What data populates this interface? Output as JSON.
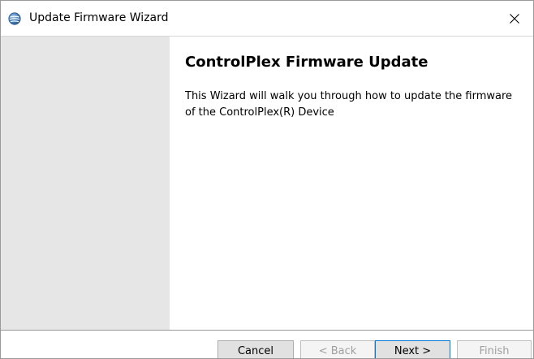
{
  "window": {
    "title": "Update Firmware Wizard",
    "icon": "globe-app-icon",
    "close_glyph": "✕"
  },
  "page": {
    "heading": "ControlPlex Firmware Update",
    "description": "This Wizard will walk you through how to update the firmware of the ControlPlex(R) Device"
  },
  "buttons": {
    "cancel": "Cancel",
    "back": "< Back",
    "next": "Next >",
    "finish": "Finish"
  },
  "colors": {
    "side_panel": "#e6e6e6",
    "accent_border": "#0078d7"
  }
}
